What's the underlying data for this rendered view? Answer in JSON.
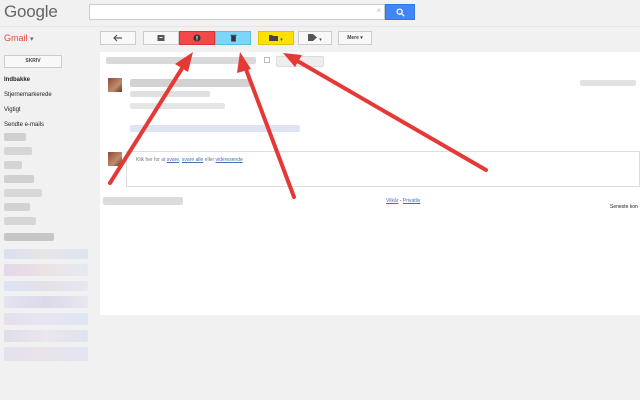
{
  "header": {
    "logo": "Google",
    "search_value": "",
    "search_clear": "×",
    "search_button_icon": "search-icon"
  },
  "toolbar": {
    "app_label": "Gmail",
    "app_caret": "▾",
    "back_icon": "back-arrow-icon",
    "archive_icon": "archive-icon",
    "spam_icon": "spam-icon",
    "delete_icon": "trash-icon",
    "move_icon": "folder-icon",
    "labels_icon": "label-icon",
    "more_label": "Mere",
    "spam_color": "#f24848",
    "delete_color": "#7dd6f7",
    "move_color": "#ffe100"
  },
  "sidebar": {
    "compose_label": "SKRIV",
    "items": [
      {
        "label": "Indbakke",
        "active": true
      },
      {
        "label": "Stjernemarkerede",
        "active": false
      },
      {
        "label": "Vigtigt",
        "active": false
      },
      {
        "label": "Sendte e-mails",
        "active": false
      }
    ]
  },
  "reply": {
    "prefix": "Klik her for at",
    "reply": "svare",
    "reply_all": "svare alle",
    "or": "eller",
    "forward": "videresende"
  },
  "footer": {
    "terms": "Vilkår",
    "privacy": "Privatliv",
    "last_activity": "Seneste kon"
  },
  "annotations": {
    "arrow_color": "#e53935"
  }
}
